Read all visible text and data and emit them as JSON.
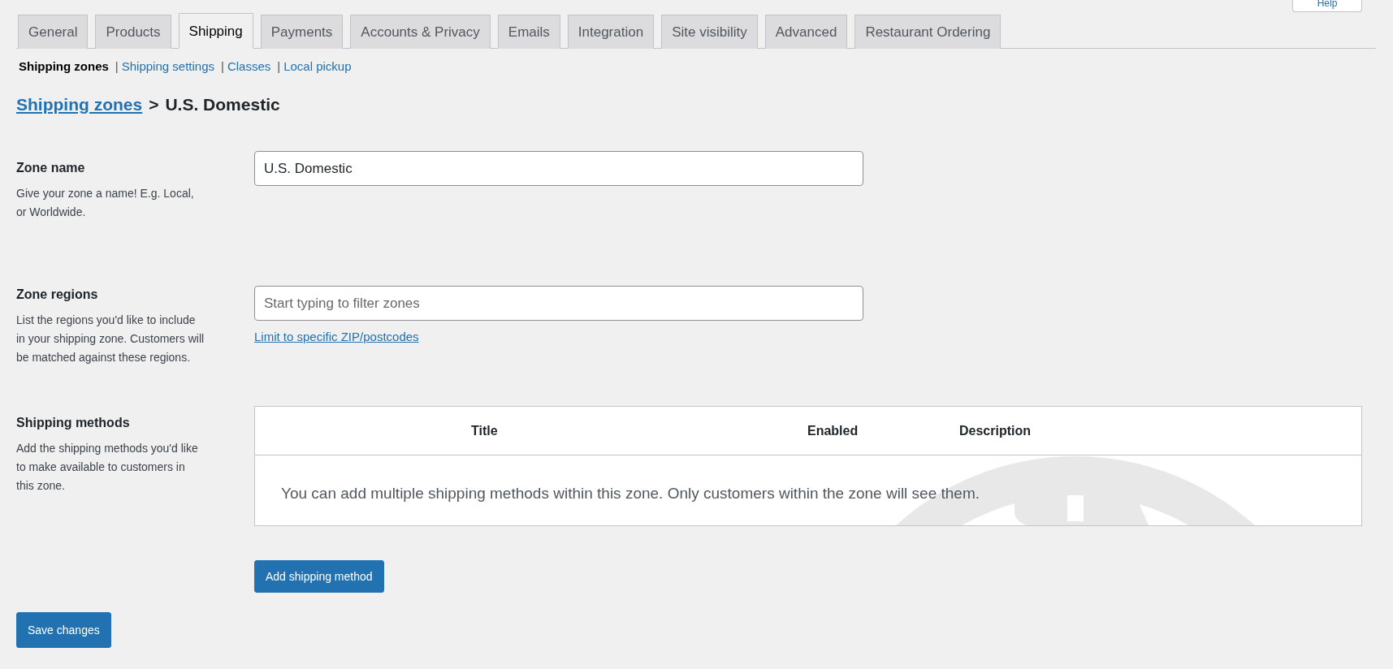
{
  "help_button": "Help",
  "tabs": [
    {
      "label": "General",
      "selected": false
    },
    {
      "label": "Products",
      "selected": false
    },
    {
      "label": "Shipping",
      "selected": true
    },
    {
      "label": "Payments",
      "selected": false
    },
    {
      "label": "Accounts & Privacy",
      "selected": false
    },
    {
      "label": "Emails",
      "selected": false
    },
    {
      "label": "Integration",
      "selected": false
    },
    {
      "label": "Site visibility",
      "selected": false
    },
    {
      "label": "Advanced",
      "selected": false
    },
    {
      "label": "Restaurant Ordering",
      "selected": false
    }
  ],
  "subnav": [
    {
      "label": "Shipping zones",
      "selected": true
    },
    {
      "prefix": "|",
      "label": "Shipping settings",
      "selected": false
    },
    {
      "prefix": "|",
      "label": "Classes",
      "selected": false
    },
    {
      "prefix": "|",
      "label": "Local pickup",
      "selected": false
    }
  ],
  "breadcrumb": {
    "link": "Shipping zones",
    "separator": ">",
    "current": "U.S. Domestic"
  },
  "fields": [
    {
      "kind": "text",
      "label": "Zone name",
      "description": "Give your zone a name! E.g. Local, or Worldwide.",
      "value": "U.S. Domestic"
    },
    {
      "kind": "regions",
      "label": "Zone regions",
      "description": "List the regions you'd like to include in your shipping zone. Customers will be matched against these regions.",
      "placeholder": "Start typing to filter zones",
      "link": "Limit to specific ZIP/postcodes"
    },
    {
      "kind": "methods",
      "label": "Shipping methods",
      "description": "Add the shipping methods you'd like to make available to customers in this zone.",
      "columns": [
        "Title",
        "Enabled",
        "Description"
      ],
      "empty_message": "You can add multiple shipping methods within this zone. Only customers within the zone will see them.",
      "button": "Add shipping method"
    }
  ],
  "save_button": "Save changes"
}
